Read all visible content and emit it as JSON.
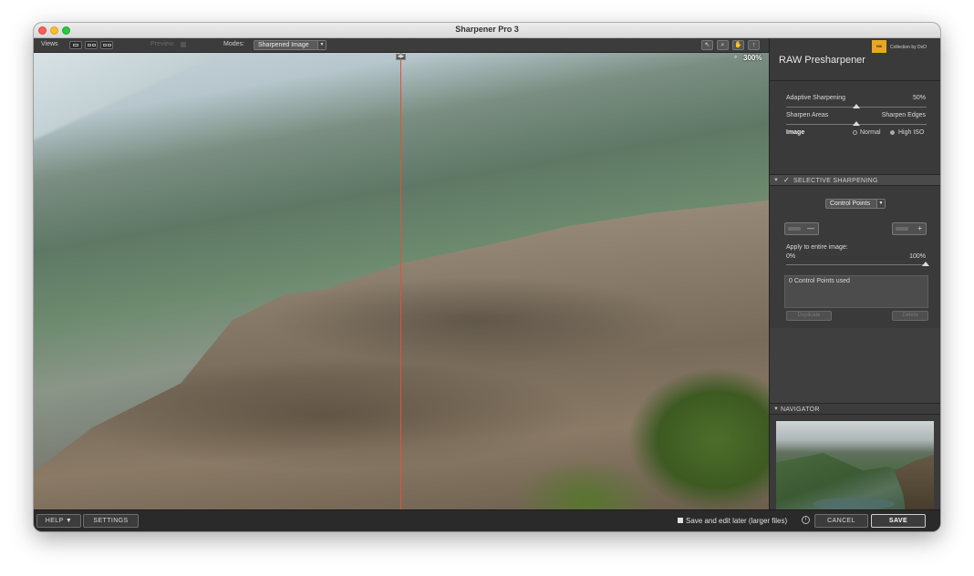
{
  "window": {
    "title": "Sharpener Pro 3"
  },
  "toolbar": {
    "views_label": "Views",
    "preview_label": "Preview:",
    "modes_label": "Modes:",
    "mode_value": "Sharpened Image",
    "tool_icons": [
      "arrow-pointer-icon",
      "zoom-icon",
      "hand-icon",
      "eyedropper-icon"
    ]
  },
  "canvas": {
    "zoom": "300%"
  },
  "panel": {
    "brand_text": "Collection by DxO",
    "title": "RAW Presharpener",
    "adaptive_label": "Adaptive Sharpening",
    "adaptive_value": "50%",
    "adaptive_level": 0.5,
    "sharpen_areas": "Sharpen Areas",
    "sharpen_edges": "Sharpen Edges",
    "image_label": "Image",
    "radio_normal": "Normal",
    "radio_high_iso": "High ISO",
    "selective_title": "SELECTIVE SHARPENING",
    "control_points_value": "Control Points",
    "apply_label": "Apply to entire image:",
    "apply_min": "0%",
    "apply_max": "100%",
    "apply_level": 1.0,
    "cp_used": "0 Control Points used",
    "duplicate": "Duplicate",
    "delete": "Delete",
    "navigator_title": "NAVIGATOR"
  },
  "bottom": {
    "help": "HELP ▼",
    "settings": "SETTINGS",
    "save_later": "Save and edit later (larger files)",
    "cancel": "CANCEL",
    "save": "SAVE"
  },
  "colors": {
    "split_line": "#d9563a",
    "brand": "#e9a823"
  }
}
